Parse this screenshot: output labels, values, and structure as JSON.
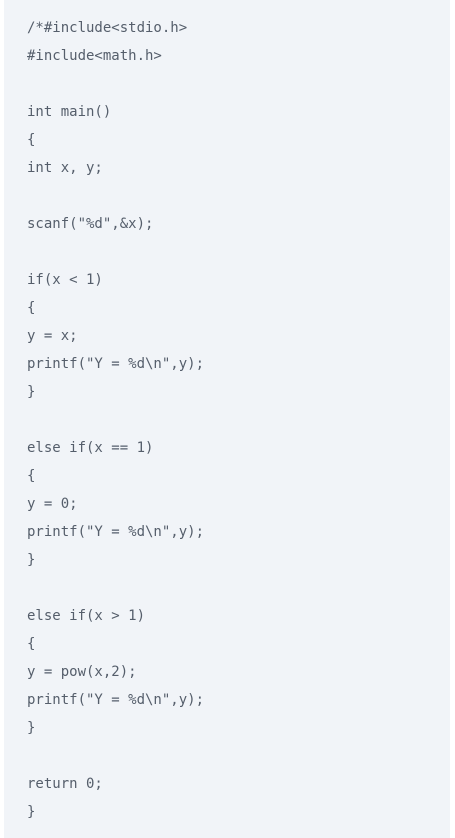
{
  "code": {
    "lines": [
      "/*#include<stdio.h>",
      "#include<math.h>",
      "",
      "int main()",
      "{",
      "int x, y;",
      "",
      "scanf(\"%d\",&x);",
      "",
      "if(x < 1)",
      "{",
      "y = x;",
      "printf(\"Y = %d\\n\",y);",
      "}",
      "",
      "else if(x == 1)",
      "{",
      "y = 0;",
      "printf(\"Y = %d\\n\",y);",
      "}",
      "",
      "else if(x > 1)",
      "{",
      "y = pow(x,2);",
      "printf(\"Y = %d\\n\",y);",
      "}",
      "",
      "return 0;",
      "}"
    ]
  }
}
